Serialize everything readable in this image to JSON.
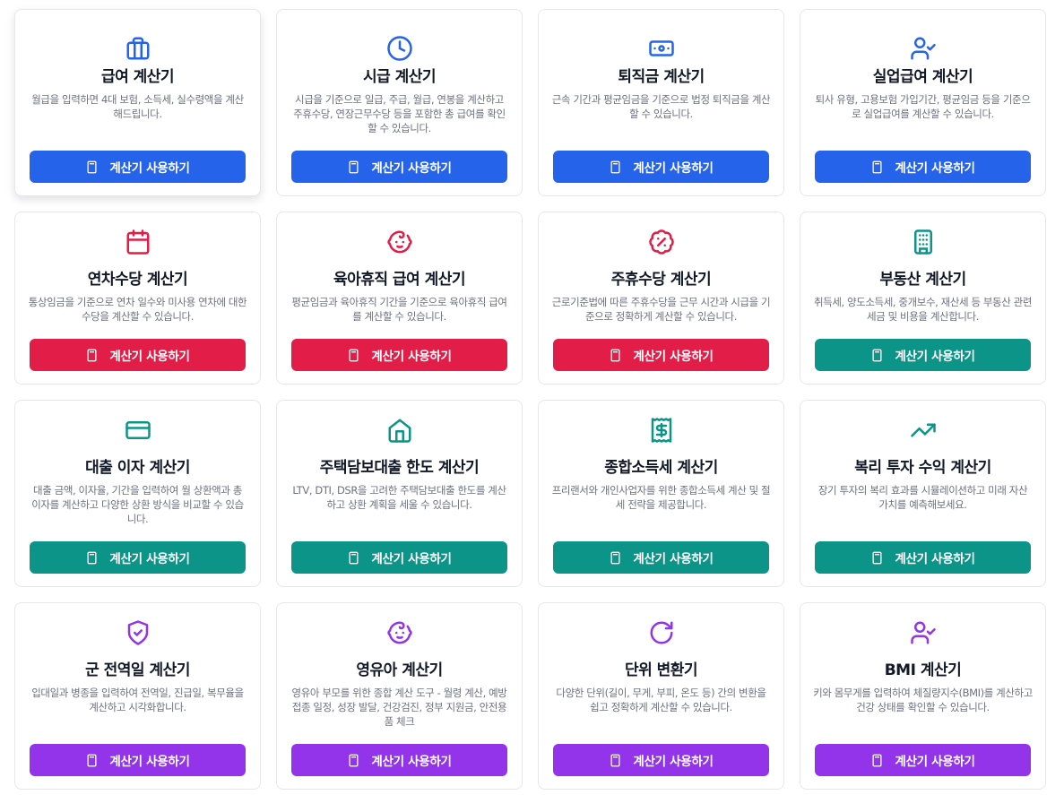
{
  "button_label": "계산기 사용하기",
  "cards": [
    {
      "title": "급여 계산기",
      "desc": "월급을 입력하면 4대 보험, 소득세, 실수령액을 계산해드립니다.",
      "icon": "briefcase-icon",
      "color": "#2563eb"
    },
    {
      "title": "시급 계산기",
      "desc": "시급을 기준으로 일급, 주급, 월급, 연봉을 계산하고 주휴수당, 연장근무수당 등을 포함한 총 급여를 확인할 수 있습니다.",
      "icon": "clock-icon",
      "color": "#2563eb"
    },
    {
      "title": "퇴직금 계산기",
      "desc": "근속 기간과 평균임금을 기준으로 법정 퇴직금을 계산할 수 있습니다.",
      "icon": "banknote-icon",
      "color": "#2563eb"
    },
    {
      "title": "실업급여 계산기",
      "desc": "퇴사 유형, 고용보험 가입기간, 평균임금 등을 기준으로 실업급여를 계산할 수 있습니다.",
      "icon": "user-check-icon",
      "color": "#2563eb"
    },
    {
      "title": "연차수당 계산기",
      "desc": "통상임금을 기준으로 연차 일수와 미사용 연차에 대한 수당을 계산할 수 있습니다.",
      "icon": "calendar-icon",
      "color": "#e11d48"
    },
    {
      "title": "육아휴직 급여 계산기",
      "desc": "평균임금과 육아휴직 기간을 기준으로 육아휴직 급여를 계산할 수 있습니다.",
      "icon": "baby-icon",
      "color": "#e11d48"
    },
    {
      "title": "주휴수당 계산기",
      "desc": "근로기준법에 따른 주휴수당을 근무 시간과 시급을 기준으로 정확하게 계산할 수 있습니다.",
      "icon": "percent-badge-icon",
      "color": "#e11d48"
    },
    {
      "title": "부동산 계산기",
      "desc": "취득세, 양도소득세, 중개보수, 재산세 등 부동산 관련 세금 및 비용을 계산합니다.",
      "icon": "building-icon",
      "color": "#0d9488"
    },
    {
      "title": "대출 이자 계산기",
      "desc": "대출 금액, 이자율, 기간을 입력하여 월 상환액과 총 이자를 계산하고 다양한 상환 방식을 비교할 수 있습니다.",
      "icon": "credit-card-icon",
      "color": "#0d9488"
    },
    {
      "title": "주택담보대출 한도 계산기",
      "desc": "LTV, DTI, DSR을 고려한 주택담보대출 한도를 계산하고 상환 계획을 세울 수 있습니다.",
      "icon": "home-icon",
      "color": "#0d9488"
    },
    {
      "title": "종합소득세 계산기",
      "desc": "프리랜서와 개인사업자를 위한 종합소득세 계산 및 절세 전략을 제공합니다.",
      "icon": "receipt-icon",
      "color": "#0d9488"
    },
    {
      "title": "복리 투자 수익 계산기",
      "desc": "장기 투자의 복리 효과를 시뮬레이션하고 미래 자산 가치를 예측해보세요.",
      "icon": "trending-up-icon",
      "color": "#0d9488"
    },
    {
      "title": "군 전역일 계산기",
      "desc": "입대일과 병종을 입력하여 전역일, 진급일, 복무율을 계산하고 시각화합니다.",
      "icon": "shield-check-icon",
      "color": "#9333ea"
    },
    {
      "title": "영유아 계산기",
      "desc": "영유아 부모를 위한 종합 계산 도구 - 월령 계산, 예방접종 일정, 성장 발달, 건강검진, 정부 지원금, 안전용품 체크",
      "icon": "baby-icon",
      "color": "#9333ea"
    },
    {
      "title": "단위 변환기",
      "desc": "다양한 단위(길이, 무게, 부피, 온도 등) 간의 변환을 쉽고 정확하게 계산할 수 있습니다.",
      "icon": "rotate-cw-icon",
      "color": "#9333ea"
    },
    {
      "title": "BMI 계산기",
      "desc": "키와 몸무게를 입력하여 체질량지수(BMI)를 계산하고 건강 상태를 확인할 수 있습니다.",
      "icon": "user-check-icon",
      "color": "#9333ea"
    }
  ]
}
